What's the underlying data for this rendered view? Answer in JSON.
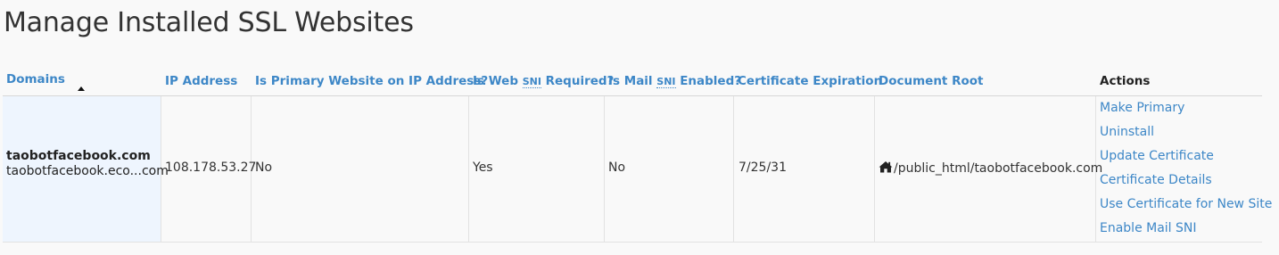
{
  "page": {
    "title": "Manage Installed SSL Websites"
  },
  "table": {
    "headers": {
      "domains": "Domains",
      "ip_address": "IP Address",
      "is_primary": "Is Primary Website on IP Address?",
      "web_sni_prefix": "Is Web ",
      "web_sni_abbr": "SNI",
      "web_sni_suffix": " Required?",
      "mail_sni_prefix": "Is Mail ",
      "mail_sni_abbr": "SNI",
      "mail_sni_suffix": " Enabled?",
      "cert_expiration": "Certificate Expiration",
      "doc_root": "Document Root",
      "actions": "Actions"
    },
    "sort": {
      "column": "Domains",
      "icon": "sort-up-caret-icon"
    },
    "rows": [
      {
        "domain": "taobotfacebook.com",
        "alias": "taobotfacebook.eco...com",
        "ip_address": "108.178.53.27",
        "is_primary": "No",
        "web_sni_required": "Yes",
        "mail_sni_enabled": "No",
        "cert_expiration": "7/25/31",
        "doc_root_icon": "home-icon",
        "doc_root": "/public_html/taobotfacebook.com",
        "actions": [
          "Make Primary",
          "Uninstall",
          "Update Certificate",
          "Certificate Details",
          "Use Certificate for New Site",
          "Enable Mail SNI"
        ]
      }
    ]
  },
  "colors": {
    "link": "#3d87c7",
    "domain_cell_bg": "#eef5fe",
    "page_bg": "#f9f9f9"
  }
}
